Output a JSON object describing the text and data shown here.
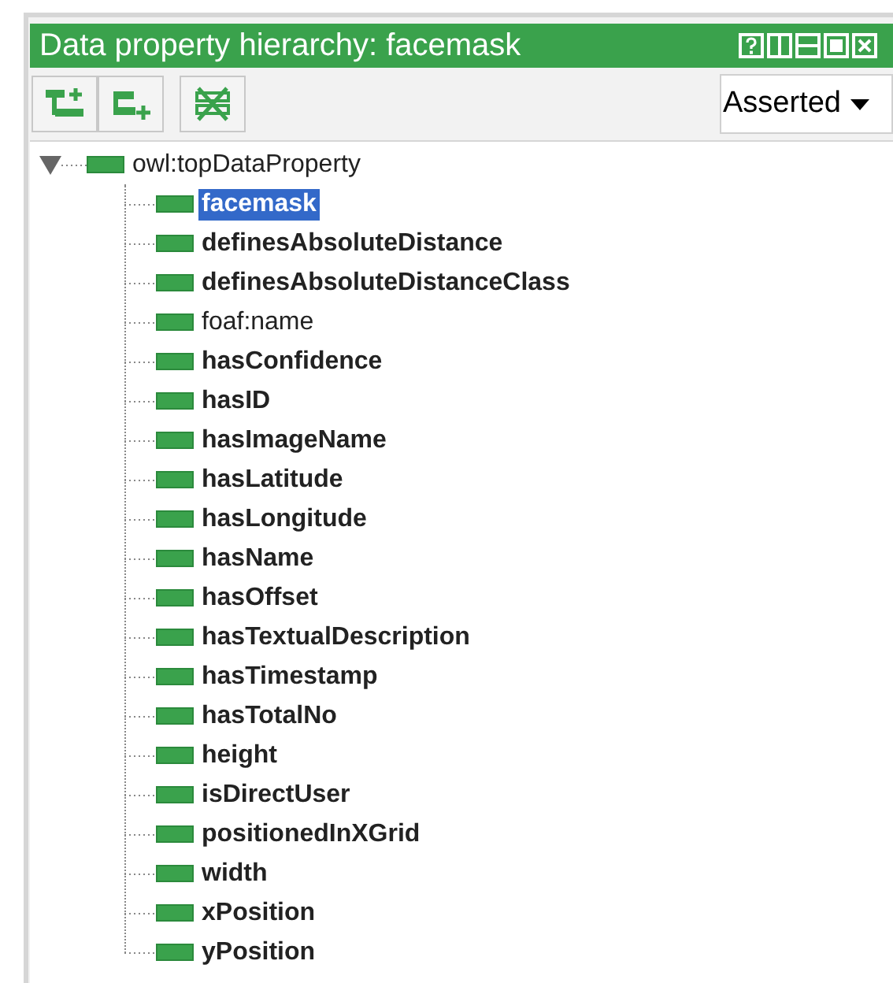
{
  "panel": {
    "title": "Data property hierarchy: facemask"
  },
  "toolbar": {
    "mode": "Asserted"
  },
  "tree": {
    "label": "owl:topDataProperty",
    "bold": false,
    "selected": false,
    "expanded": true,
    "children": [
      {
        "label": "facemask",
        "bold": true,
        "selected": true
      },
      {
        "label": "definesAbsoluteDistance",
        "bold": true,
        "selected": false
      },
      {
        "label": "definesAbsoluteDistanceClass",
        "bold": true,
        "selected": false
      },
      {
        "label": "foaf:name",
        "bold": false,
        "selected": false
      },
      {
        "label": "hasConfidence",
        "bold": true,
        "selected": false
      },
      {
        "label": "hasID",
        "bold": true,
        "selected": false
      },
      {
        "label": "hasImageName",
        "bold": true,
        "selected": false
      },
      {
        "label": "hasLatitude",
        "bold": true,
        "selected": false
      },
      {
        "label": "hasLongitude",
        "bold": true,
        "selected": false
      },
      {
        "label": "hasName",
        "bold": true,
        "selected": false
      },
      {
        "label": "hasOffset",
        "bold": true,
        "selected": false
      },
      {
        "label": "hasTextualDescription",
        "bold": true,
        "selected": false
      },
      {
        "label": "hasTimestamp",
        "bold": true,
        "selected": false
      },
      {
        "label": "hasTotalNo",
        "bold": true,
        "selected": false
      },
      {
        "label": "height",
        "bold": true,
        "selected": false
      },
      {
        "label": "isDirectUser",
        "bold": true,
        "selected": false
      },
      {
        "label": "positionedInXGrid",
        "bold": true,
        "selected": false
      },
      {
        "label": "width",
        "bold": true,
        "selected": false
      },
      {
        "label": "xPosition",
        "bold": true,
        "selected": false
      },
      {
        "label": "yPosition",
        "bold": true,
        "selected": false
      }
    ]
  }
}
